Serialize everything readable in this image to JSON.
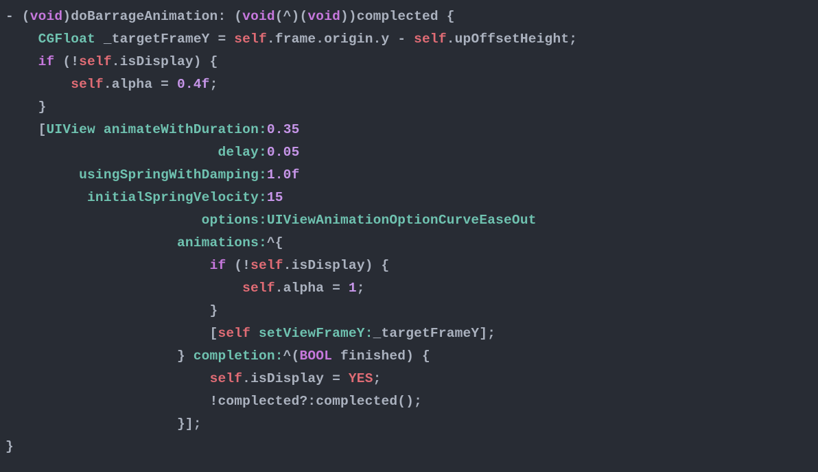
{
  "colors": {
    "bg": "#282c34",
    "default": "#abb2bf",
    "keyword": "#c678dd",
    "type": "#6fc2b0",
    "self": "#e06c75",
    "prop": "#abb2bf",
    "func": "#6fc2b0",
    "num": "#c695e8",
    "const": "#e06c75",
    "param": "#abb2bf"
  },
  "lines": [
    [
      {
        "t": "- (",
        "c": "default"
      },
      {
        "t": "void",
        "c": "keyword"
      },
      {
        "t": ")doBarrageAnimation: (",
        "c": "default"
      },
      {
        "t": "void",
        "c": "keyword"
      },
      {
        "t": "(^)(",
        "c": "default"
      },
      {
        "t": "void",
        "c": "keyword"
      },
      {
        "t": "))complected {",
        "c": "default"
      }
    ],
    [
      {
        "t": "    ",
        "c": "default"
      },
      {
        "t": "CGFloat",
        "c": "type"
      },
      {
        "t": " _targetFrameY = ",
        "c": "default"
      },
      {
        "t": "self",
        "c": "self"
      },
      {
        "t": ".frame.origin.y - ",
        "c": "default"
      },
      {
        "t": "self",
        "c": "self"
      },
      {
        "t": ".upOffsetHeight;",
        "c": "default"
      }
    ],
    [
      {
        "t": "    ",
        "c": "default"
      },
      {
        "t": "if",
        "c": "keyword"
      },
      {
        "t": " (!",
        "c": "default"
      },
      {
        "t": "self",
        "c": "self"
      },
      {
        "t": ".isDisplay) {",
        "c": "default"
      }
    ],
    [
      {
        "t": "        ",
        "c": "default"
      },
      {
        "t": "self",
        "c": "self"
      },
      {
        "t": ".alpha = ",
        "c": "default"
      },
      {
        "t": "0.4f",
        "c": "num"
      },
      {
        "t": ";",
        "c": "default"
      }
    ],
    [
      {
        "t": "    }",
        "c": "default"
      }
    ],
    [
      {
        "t": "    [",
        "c": "default"
      },
      {
        "t": "UIView",
        "c": "type"
      },
      {
        "t": " ",
        "c": "default"
      },
      {
        "t": "animateWithDuration:",
        "c": "func"
      },
      {
        "t": "0.35",
        "c": "num"
      }
    ],
    [
      {
        "t": "                          ",
        "c": "default"
      },
      {
        "t": "delay:",
        "c": "func"
      },
      {
        "t": "0.05",
        "c": "num"
      }
    ],
    [
      {
        "t": "         ",
        "c": "default"
      },
      {
        "t": "usingSpringWithDamping:",
        "c": "func"
      },
      {
        "t": "1.0f",
        "c": "num"
      }
    ],
    [
      {
        "t": "          ",
        "c": "default"
      },
      {
        "t": "initialSpringVelocity:",
        "c": "func"
      },
      {
        "t": "15",
        "c": "num"
      }
    ],
    [
      {
        "t": "                        ",
        "c": "default"
      },
      {
        "t": "options:",
        "c": "func"
      },
      {
        "t": "UIViewAnimationOptionCurveEaseOut",
        "c": "type"
      }
    ],
    [
      {
        "t": "                     ",
        "c": "default"
      },
      {
        "t": "animations:",
        "c": "func"
      },
      {
        "t": "^{",
        "c": "default"
      }
    ],
    [
      {
        "t": "                         ",
        "c": "default"
      },
      {
        "t": "if",
        "c": "keyword"
      },
      {
        "t": " (!",
        "c": "default"
      },
      {
        "t": "self",
        "c": "self"
      },
      {
        "t": ".isDisplay) {",
        "c": "default"
      }
    ],
    [
      {
        "t": "                             ",
        "c": "default"
      },
      {
        "t": "self",
        "c": "self"
      },
      {
        "t": ".alpha = ",
        "c": "default"
      },
      {
        "t": "1",
        "c": "num"
      },
      {
        "t": ";",
        "c": "default"
      }
    ],
    [
      {
        "t": "                         }",
        "c": "default"
      }
    ],
    [
      {
        "t": "                         [",
        "c": "default"
      },
      {
        "t": "self",
        "c": "self"
      },
      {
        "t": " ",
        "c": "default"
      },
      {
        "t": "setViewFrameY:",
        "c": "func"
      },
      {
        "t": "_targetFrameY];",
        "c": "default"
      }
    ],
    [
      {
        "t": "                     } ",
        "c": "default"
      },
      {
        "t": "completion:",
        "c": "func"
      },
      {
        "t": "^(",
        "c": "default"
      },
      {
        "t": "BOOL",
        "c": "keyword"
      },
      {
        "t": " finished) {",
        "c": "default"
      }
    ],
    [
      {
        "t": "                         ",
        "c": "default"
      },
      {
        "t": "self",
        "c": "self"
      },
      {
        "t": ".isDisplay = ",
        "c": "default"
      },
      {
        "t": "YES",
        "c": "const"
      },
      {
        "t": ";",
        "c": "default"
      }
    ],
    [
      {
        "t": "                         !complected?:complected();",
        "c": "default"
      }
    ],
    [
      {
        "t": "                     }];",
        "c": "default"
      }
    ],
    [
      {
        "t": "}",
        "c": "default"
      }
    ]
  ]
}
